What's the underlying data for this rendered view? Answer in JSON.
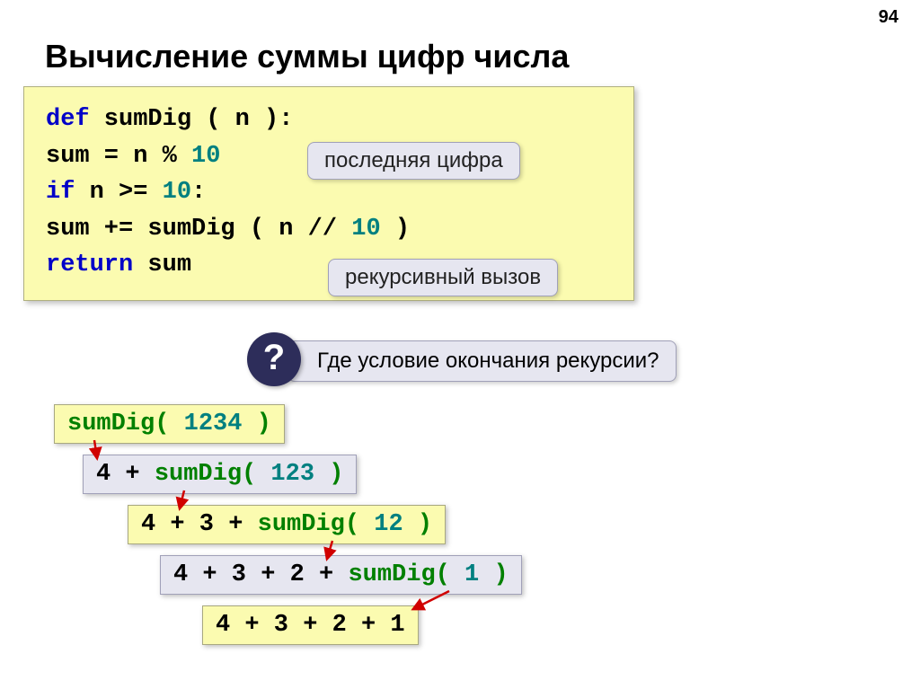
{
  "pageNumber": "94",
  "title": "Вычисление суммы цифр числа",
  "code": {
    "l1_def": "def",
    "l1_rest": " sumDig ( n ):",
    "l2_a": "   sum = n % ",
    "l2_ten": "10",
    "l3_if": "if",
    "l3_mid": " n >= ",
    "l3_ten": "10",
    "l3_colon": ":",
    "l4_a": "    sum += sumDig ( n // ",
    "l4_ten": "10",
    "l4_end": " )",
    "l5_ret": "return",
    "l5_rest": " sum"
  },
  "callouts": {
    "lastDigit": "последняя цифра",
    "recursiveCall": "рекурсивный вызов",
    "question": "Где условие окончания рекурсии?"
  },
  "qmark": "?",
  "steps": {
    "s1_fn": "sumDig(",
    "s1_arg": " 1234 ",
    "s1_end": ")",
    "s2_pre": "4 + ",
    "s2_fn": "sumDig(",
    "s2_arg": " 123 ",
    "s2_end": ")",
    "s3_pre": "4 + 3 + ",
    "s3_fn": "sumDig(",
    "s3_arg": " 12 ",
    "s3_end": ")",
    "s4_pre": "4 + 3 + 2 + ",
    "s4_fn": "sumDig(",
    "s4_arg": " 1 ",
    "s4_end": ")",
    "s5": "4 + 3 + 2 + 1"
  }
}
